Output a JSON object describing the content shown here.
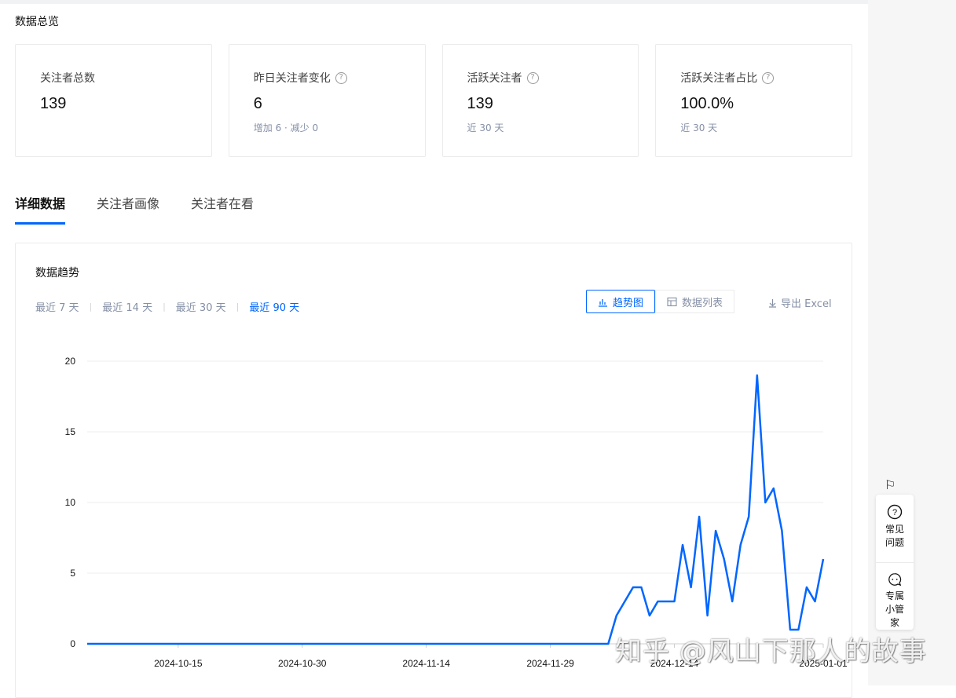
{
  "overview": {
    "title": "数据总览",
    "cards": [
      {
        "label": "关注者总数",
        "value": "139",
        "sub": ""
      },
      {
        "label": "昨日关注者变化",
        "value": "6",
        "sub": "增加 6 · 减少 0"
      },
      {
        "label": "活跃关注者",
        "value": "139",
        "sub": "近 30 天"
      },
      {
        "label": "活跃关注者占比",
        "value": "100.0%",
        "sub": "近 30 天"
      }
    ]
  },
  "tabs": [
    "详细数据",
    "关注者画像",
    "关注者在看"
  ],
  "panel": {
    "title": "数据趋势",
    "ranges": [
      "最近 7 天",
      "最近 14 天",
      "最近 30 天",
      "最近 90 天"
    ],
    "active_range": "最近 90 天",
    "views": {
      "trend": "趋势图",
      "list": "数据列表"
    },
    "export": "导出 Excel"
  },
  "chart_data": {
    "type": "line",
    "ylim": [
      0,
      20
    ],
    "y_ticks": [
      0,
      5,
      10,
      15,
      20
    ],
    "x_tick_labels": [
      "2024-10-15",
      "2024-10-30",
      "2024-11-14",
      "2024-11-29",
      "2024-12-14",
      "2025-01-01"
    ],
    "x_start": "2024-10-04",
    "x_end": "2025-01-01",
    "series": [
      {
        "color": "#0066ff",
        "points": [
          [
            "2024-10-04",
            0
          ],
          [
            "2024-12-06",
            0
          ],
          [
            "2024-12-07",
            2
          ],
          [
            "2024-12-09",
            4
          ],
          [
            "2024-12-10",
            4
          ],
          [
            "2024-12-11",
            2
          ],
          [
            "2024-12-12",
            3
          ],
          [
            "2024-12-13",
            3
          ],
          [
            "2024-12-14",
            3
          ],
          [
            "2024-12-15",
            7
          ],
          [
            "2024-12-16",
            4
          ],
          [
            "2024-12-17",
            9
          ],
          [
            "2024-12-18",
            2
          ],
          [
            "2024-12-19",
            8
          ],
          [
            "2024-12-20",
            6
          ],
          [
            "2024-12-21",
            3
          ],
          [
            "2024-12-22",
            7
          ],
          [
            "2024-12-23",
            9
          ],
          [
            "2024-12-24",
            19
          ],
          [
            "2024-12-25",
            10
          ],
          [
            "2024-12-26",
            11
          ],
          [
            "2024-12-27",
            8
          ],
          [
            "2024-12-28",
            1
          ],
          [
            "2024-12-29",
            1
          ],
          [
            "2024-12-30",
            4
          ],
          [
            "2024-12-31",
            3
          ],
          [
            "2025-01-01",
            6
          ]
        ]
      }
    ],
    "grid": true
  },
  "float_bar": {
    "faq": "常见问题",
    "manager": "专属小管家"
  },
  "watermark": "知乎 @风山下那人的故事"
}
